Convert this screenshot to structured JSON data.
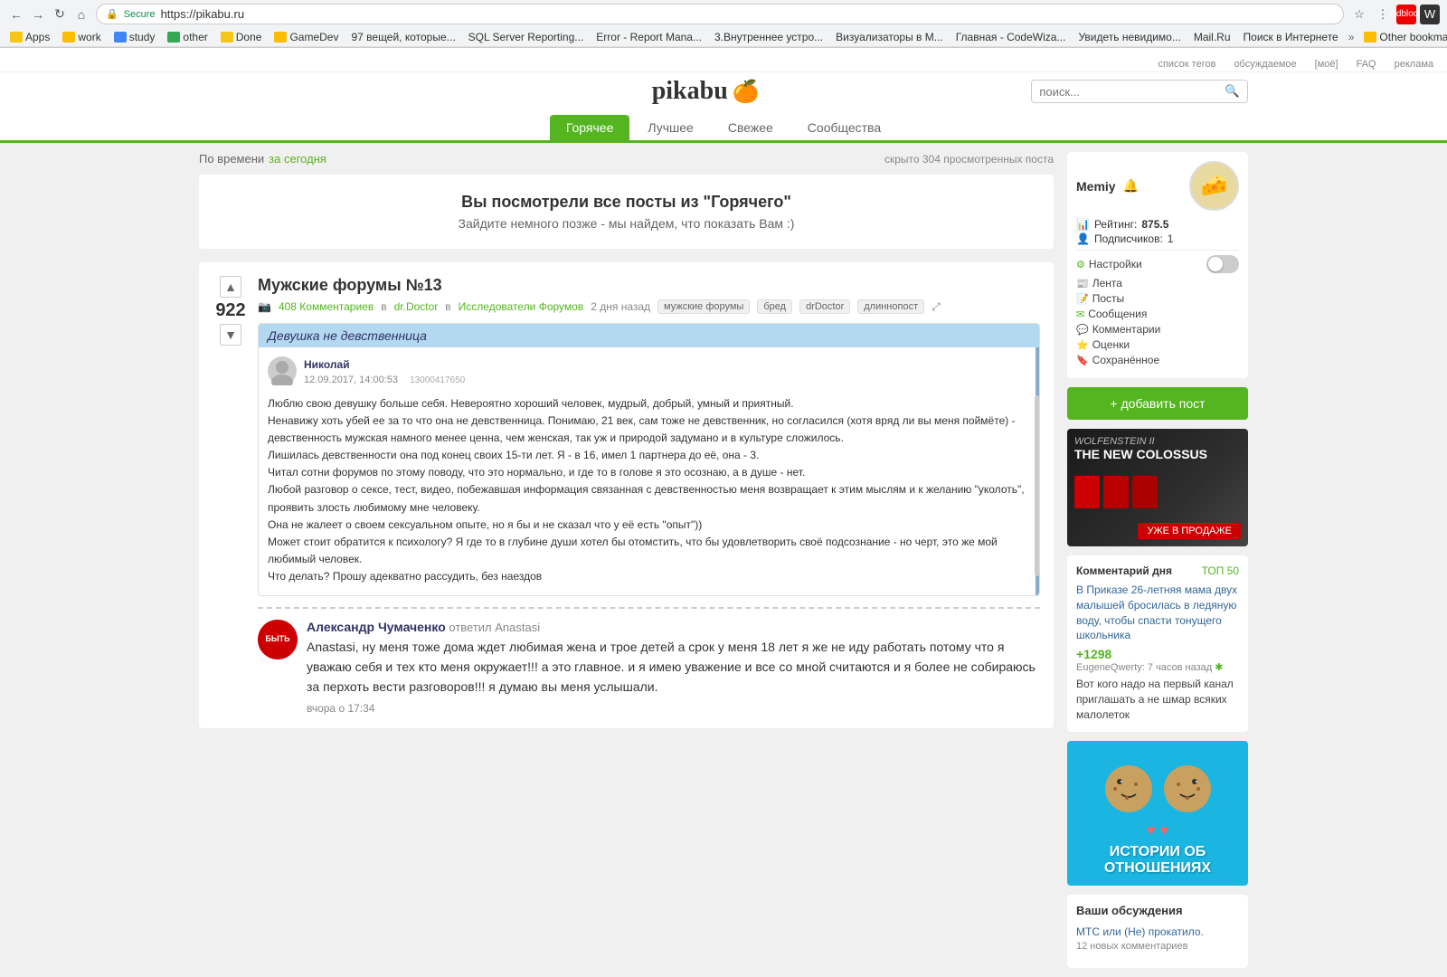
{
  "browser": {
    "back_btn": "←",
    "forward_btn": "→",
    "refresh_btn": "↻",
    "home_btn": "⌂",
    "url": "https://pikabu.ru",
    "secure_label": "Secure",
    "search_icon": "🔍",
    "star_icon": "☆",
    "menu_icon": "⋮",
    "bookmarks": [
      {
        "label": "Apps",
        "type": "folder"
      },
      {
        "label": "work",
        "type": "folder"
      },
      {
        "label": "study",
        "type": "folder"
      },
      {
        "label": "other",
        "type": "folder"
      },
      {
        "label": "Done",
        "type": "folder"
      },
      {
        "label": "GameDev",
        "type": "folder"
      },
      {
        "label": "97 вещей, которые...",
        "type": "link"
      },
      {
        "label": "SQL Server Reporting...",
        "type": "link"
      },
      {
        "label": "Error - Report Mana...",
        "type": "link"
      },
      {
        "label": "3.Внутреннее устро...",
        "type": "link"
      },
      {
        "label": "Визуализаторы в М...",
        "type": "link"
      },
      {
        "label": "Главная - CodeWiza...",
        "type": "link"
      },
      {
        "label": "Увидеть невидимо...",
        "type": "link"
      },
      {
        "label": "Mail.Ru",
        "type": "link"
      },
      {
        "label": "Поиск в Интернете",
        "type": "link"
      }
    ],
    "other_bookmarks": "Other bookmarks"
  },
  "site": {
    "logo": "pikabu",
    "logo_emoji": "🍊",
    "nav_tabs": [
      {
        "label": "Горячее",
        "active": true
      },
      {
        "label": "Лучшее",
        "active": false
      },
      {
        "label": "Свежее",
        "active": false
      },
      {
        "label": "Сообщества",
        "active": false
      }
    ],
    "search_placeholder": "поиск...",
    "top_links": [
      "список тегов",
      "обсуждаемое",
      "[моё]",
      "FAQ",
      "реклама"
    ]
  },
  "filter_bar": {
    "left_text": "По времени",
    "link_text": "за сегодня",
    "right_text": "скрыто 304 просмотренных поста"
  },
  "all_hot_message": {
    "title": "Вы посмотрели все посты из \"Горячего\"",
    "subtitle": "Зайдите немного позже - мы найдем, что показать Вам :)"
  },
  "post": {
    "vote_count": "922",
    "title": "Мужские форумы №13",
    "meta": {
      "comments_count": "408 Комментариев",
      "author": "dr.Doctor",
      "community": "Исследователи Форумов",
      "time": "2 дня назад",
      "tags": [
        "мужские форумы",
        "бред",
        "drDoctor",
        "длиннопост"
      ]
    },
    "preview_header": "Девушка не девственница",
    "preview_user": "Николай",
    "preview_date": "12.09.2017, 14:00:53",
    "preview_id": "13000417650",
    "preview_text": "Люблю свою девушку больше себя. Невероятно хороший человек, мудрый, добрый, умный и приятный.\nНенавижу хоть убей ее за то что она не девственница. Понимаю, 21 век, сам тоже не девственник, но согласился (хотя вряд ли вы меня поймёте) - девственность мужская намного менее ценна, чем женская, так уж и природой задумано и в культуре сложилось.\nЛишилась девственности она под конец своих 15-ти лет. Я - в 16, имел 1 партнера до её, она - 3.\nЧитал сотни форумов по этому поводу, что это нормально, и где то в голове я это осознаю, а в душе - нет.\nЛюбой разговор о сексе, тест, видео, побежавшая информация связанная с девственностью меня возвращает к этим мыслям и к желанию \"уколоть\", проявить злость любимому мне человеку.\nОна не жалеет о своем сексуальном опыте, но я бы и не сказал что у её есть \"опыт\"))\nМожет стоит обратится к психологу? Я где то в глубине души хотел бы отомстить, что бы удовлетворить своё подсознание - но черт, это же мой любимый человек.\nЧто делать? Прошу адекватно рассудить, без наездов"
  },
  "comment": {
    "username": "Александр Чумаченко",
    "reply_to": "ответил Anastasi",
    "avatar_text": "БЫТЬ",
    "text": "Anastasi, ну меня тоже дома ждет любимая жена и трое детей а срок у меня 18 лет я же не иду работать потому что я уважаю себя и тех кто меня окружает!!! а это главное. и я имею уважение и все со мной считаются и я более не собираюсь за перхоть вести разговоров!!! я думаю вы меня услышали.",
    "time": "вчора о 17:34"
  },
  "sidebar": {
    "username": "Memiy",
    "bell_icon": "🔔",
    "settings_icon": "⚙",
    "rating_label": "Рейтинг:",
    "rating_value": "875.5",
    "subscribers_label": "Подписчиков:",
    "subscribers_value": "1",
    "links": [
      "Настройки",
      "Лента",
      "Посты",
      "Сообщения",
      "Комментарии",
      "Оценки",
      "Сохранённое"
    ],
    "add_post_btn": "+ добавить пост",
    "comment_of_day_label": "Комментарий дня",
    "top50_label": "ТОП 50",
    "cod_link_text": "В Приказе 26-летняя мама двух малышей бросилась в ледяную воду, чтобы спасти тонущего школьника",
    "cod_score": "+1298",
    "cod_user": "EugeneQwerty:",
    "cod_time": "7 часов назад",
    "cod_comment": "Вот кого надо на первый канал приглашать а не шмар всяких малолеток",
    "relations_ad_title": "ИСТОРИИ ОБ ОТНОШЕНИЯХ",
    "discussions_title": "Ваши обсуждения",
    "discussions": [
      {
        "link": "МТС или (Не) прокатило.",
        "meta": "12 новых комментариев"
      }
    ]
  }
}
